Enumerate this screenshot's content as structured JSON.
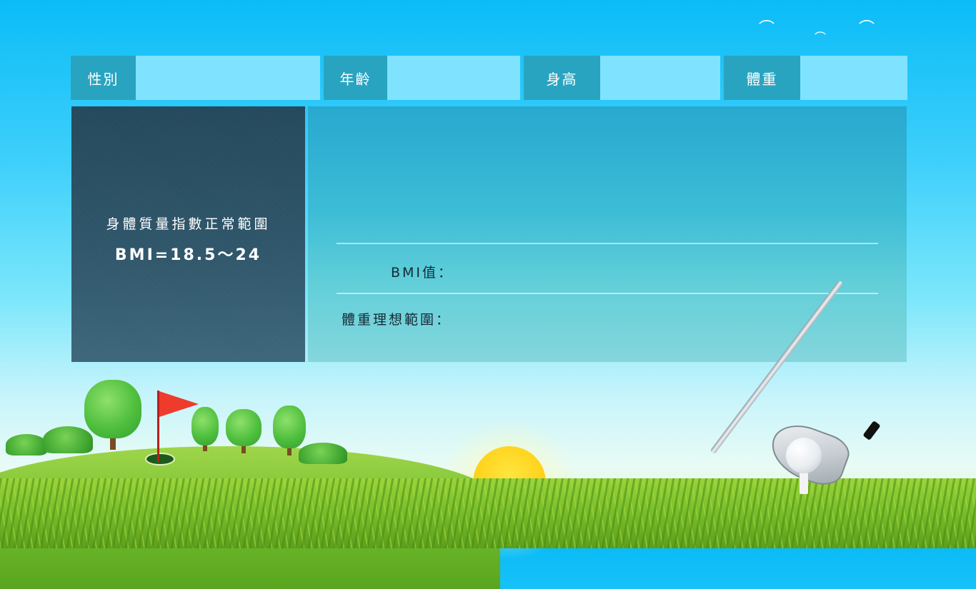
{
  "form": {
    "gender_label": "性別",
    "age_label": "年齡",
    "height_label": "身高",
    "weight_label": "體重",
    "gender_value": "",
    "age_value": "",
    "height_value": "",
    "weight_value": ""
  },
  "info_panel": {
    "title": "身體質量指數正常範圍",
    "range": "BMI=18.5～24"
  },
  "result_panel": {
    "bmi_label": "BMI值：",
    "bmi_value": "",
    "ideal_weight_label": "體重理想範圍：",
    "ideal_weight_value": ""
  }
}
